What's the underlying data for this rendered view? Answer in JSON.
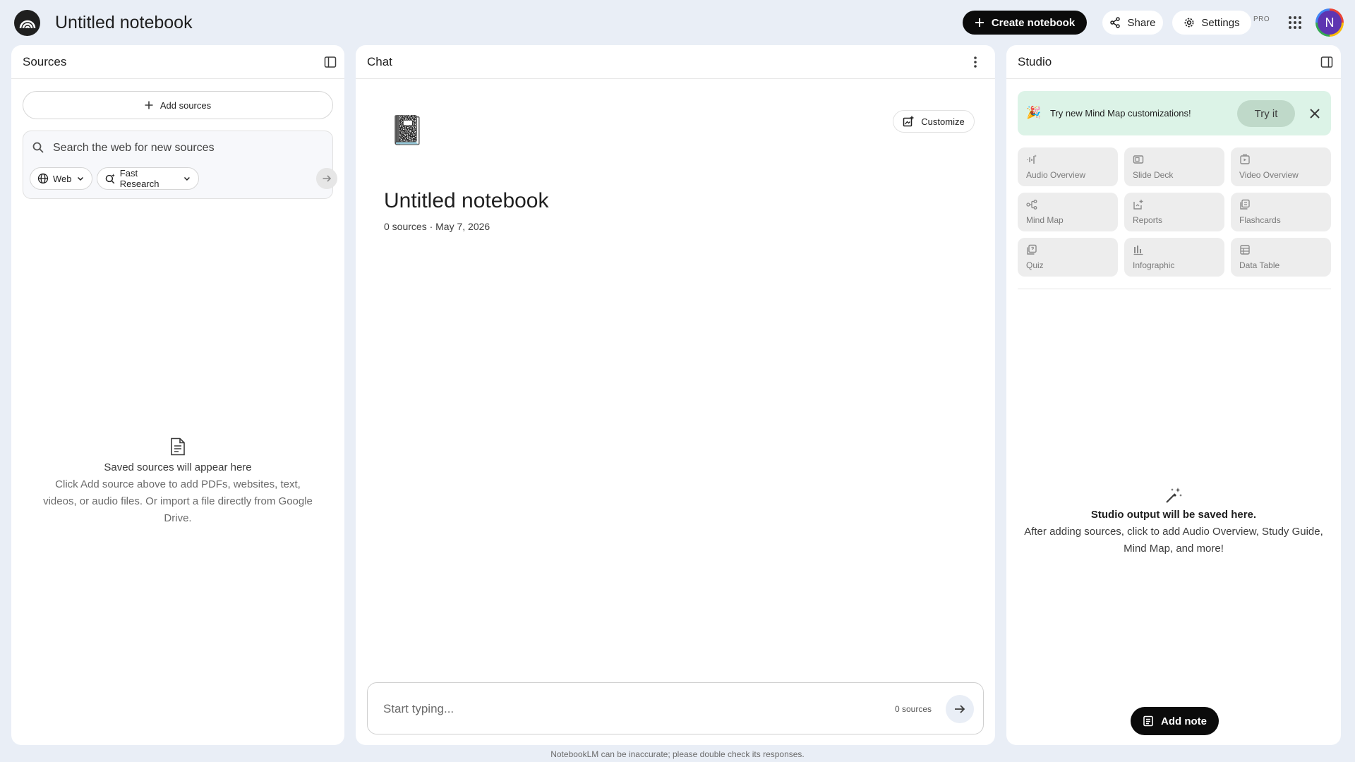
{
  "header": {
    "notebook_title": "Untitled notebook",
    "create_label": "Create notebook",
    "share_label": "Share",
    "settings_label": "Settings",
    "pro_badge": "PRO",
    "avatar_initial": "N"
  },
  "sources": {
    "title": "Sources",
    "add_label": "Add sources",
    "search_placeholder": "Search the web for new sources",
    "web_chip": "Web",
    "research_chip": "Fast Research",
    "empty_title": "Saved sources will appear here",
    "empty_desc": "Click Add source above to add PDFs, websites, text, videos, or audio files. Or import a file directly from Google Drive."
  },
  "chat": {
    "title": "Chat",
    "customize_label": "Customize",
    "notebook_emoji": "📓",
    "notebook_title": "Untitled notebook",
    "meta": "0 sources · May 7, 2026",
    "input_placeholder": "Start typing...",
    "source_count": "0 sources"
  },
  "studio": {
    "title": "Studio",
    "banner_emoji": "🎉",
    "banner_text": "Try new Mind Map customizations!",
    "tryit_label": "Try it",
    "tiles": [
      {
        "label": "Audio Overview",
        "icon": "audio-wave-icon"
      },
      {
        "label": "Slide Deck",
        "icon": "slides-icon"
      },
      {
        "label": "Video Overview",
        "icon": "video-icon"
      },
      {
        "label": "Mind Map",
        "icon": "mind-map-icon"
      },
      {
        "label": "Reports",
        "icon": "reports-icon"
      },
      {
        "label": "Flashcards",
        "icon": "flashcards-icon"
      },
      {
        "label": "Quiz",
        "icon": "quiz-icon"
      },
      {
        "label": "Infographic",
        "icon": "infographic-icon"
      },
      {
        "label": "Data Table",
        "icon": "data-table-icon"
      }
    ],
    "empty_title": "Studio output will be saved here.",
    "empty_desc": "After adding sources, click to add Audio Overview, Study Guide, Mind Map, and more!",
    "add_note_label": "Add note"
  },
  "footer": {
    "disclaimer": "NotebookLM can be inaccurate; please double check its responses."
  }
}
